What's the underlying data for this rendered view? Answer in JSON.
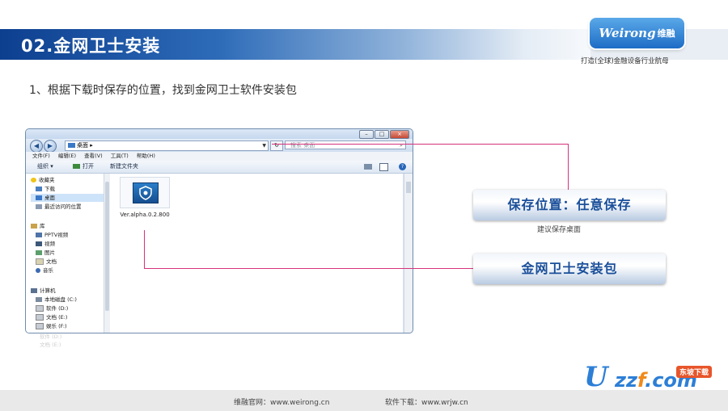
{
  "header": {
    "title": "02.金网卫士安装",
    "logo_text": "Weirong",
    "logo_cn": "维融",
    "slogan": "打造(全球)金融设备行业航母"
  },
  "instruction": "1、根据下载时保存的位置，找到金网卫士软件安装包",
  "explorer": {
    "address": "桌面",
    "search_placeholder": "搜索 桌面",
    "menu": [
      "文件(F)",
      "编辑(E)",
      "查看(V)",
      "工具(T)",
      "帮助(H)"
    ],
    "toolbar": {
      "organize": "组织 ▾",
      "open": "打开",
      "new_folder": "新建文件夹"
    },
    "nav": {
      "favorites": "收藏夹",
      "downloads": "下载",
      "desktop": "桌面",
      "recent": "最近访问的位置",
      "libraries": "库",
      "pptv": "PPTV视频",
      "videos": "视频",
      "pictures": "图片",
      "documents": "文档",
      "music": "音乐",
      "computer": "计算机",
      "drive_c": "本地磁盘 (C:)",
      "drive_d": "软件 (D:)",
      "drive_e": "文档 (E:)",
      "drive_f": "娱乐 (F:)"
    },
    "file_name": "Ver.alpha.0.2.800",
    "reflection": [
      "软件 (D:)",
      "文档 (E:)"
    ]
  },
  "callouts": {
    "location": "保存位置：任意保存",
    "location_sub": "建议保存桌面",
    "package": "金网卫士安装包"
  },
  "footer": {
    "site": "维融官网：www.weirong.cn",
    "download": "软件下载：www.wrjw.cn"
  },
  "watermark": {
    "main_u": "U",
    "rest_1": "zz",
    "rest_2": "f",
    "rest_3": ".com",
    "tag": "东坡下载"
  },
  "colors": {
    "accent_line": "#d6327a",
    "banner": "#0d3f8f",
    "callout_text": "#1a4f9a"
  }
}
